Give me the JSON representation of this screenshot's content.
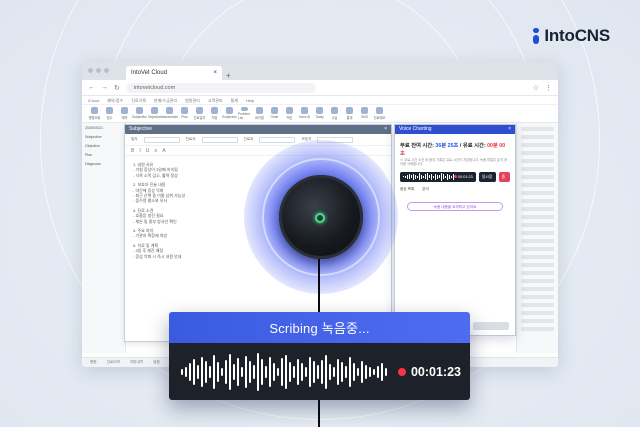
{
  "brand": {
    "name": "IntoCNS",
    "color": "#1b4fd8"
  },
  "browser": {
    "tab_title": "IntoVet Cloud",
    "url": "intovetcloud.com",
    "app_menu": [
      "iCloud",
      "예약/접수",
      "진료기록",
      "판매/수금관리",
      "병원관리",
      "고객관리",
      "통계",
      "Help"
    ],
    "toolbar_items": [
      "병원조회",
      "접수",
      "예약",
      "Subjective",
      "Objective",
      "Assessment",
      "Plan",
      "진료일지",
      "처방",
      "Subjective",
      "Problem List",
      "바이탈",
      "Order",
      "백신",
      "Voice AI",
      "Today",
      "수납",
      "통계",
      "SMS",
      "진료메모"
    ],
    "left_panel": [
      "2026/05/21",
      "Subjective",
      "Objective",
      "Plan",
      "Diagnosis"
    ],
    "status_items": [
      "병원",
      "진료이력",
      "처방내역",
      "입원",
      "수납",
      "고객정보"
    ]
  },
  "subjective": {
    "title": "Subjective",
    "form_labels": [
      "일자",
      "진료의",
      "진료과",
      "보호자"
    ],
    "tools": [
      "B",
      "I",
      "U",
      "≡",
      "A"
    ],
    "body_lines": [
      "1. 내원 사유",
      "- 기침 증상이 3일째 지속됨",
      "- 식욕 소폭 감소, 활력 정상",
      "",
      "2. 보호자 진술 내용",
      "- 야간에 증상 악화",
      "- 최근 산책 중 이물 섭취 가능성",
      "- 음수량 평소와 유사",
      "",
      "3. 진료 소견",
      "- 호흡음 청진 필요",
      "- 체온 및 흉부 방사선 확인",
      "",
      "4. 주요 처치",
      "- 기관지 확장제 처방",
      "",
      "5. 치료 및 계획",
      "- 3일 후 재진 예정",
      "- 증상 악화 시 즉시 내원 안내"
    ]
  },
  "voice_charting": {
    "title": "Voice Charting",
    "free_label": "무료 잔여 시간: ",
    "free_min": "36분 25초",
    "paid_label": " / 유료 시간: ",
    "paid_min": "00분 00초",
    "note": "※ 무료 시간 소진 후 음성 기록은 유료 시간이 차감됩니다. 녹음 파일은 분석 후 자동 삭제됩니다.",
    "time": "00:01:23",
    "btn_stop": "일시정지",
    "btn_end": "종료",
    "labels": [
      "음성 목록",
      "분석"
    ],
    "pill": "녹음 내용을 요약하고 있어요"
  },
  "scribe": {
    "label": "Scribing 녹음중...",
    "time": "00:01:23",
    "banner_color": "#3a5be0",
    "rec_color": "#ff3344"
  },
  "waveform": [
    6,
    10,
    18,
    26,
    14,
    30,
    22,
    12,
    34,
    20,
    8,
    24,
    36,
    16,
    28,
    10,
    32,
    22,
    14,
    38,
    26,
    12,
    30,
    18,
    8,
    28,
    34,
    20,
    12,
    26,
    18,
    10,
    30,
    22,
    14,
    24,
    34,
    16,
    10,
    26,
    20,
    12,
    30,
    18,
    8,
    22,
    14,
    10,
    6,
    12,
    18,
    8
  ]
}
